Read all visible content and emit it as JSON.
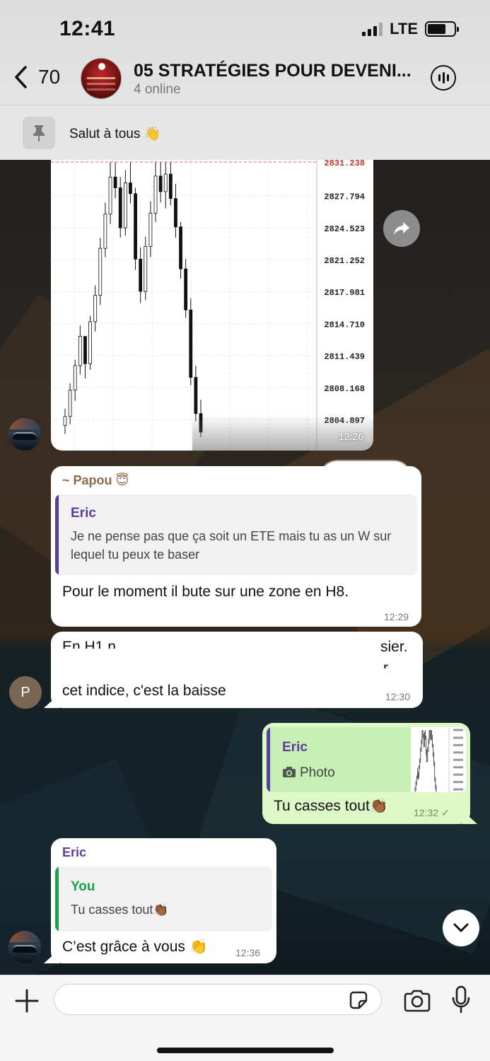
{
  "status_bar": {
    "time": "12:41",
    "network": "LTE"
  },
  "header": {
    "back_count": "70",
    "group_name": "05 STRATÉGIES POUR DEVENI...",
    "online": "4 online"
  },
  "pinned": {
    "text": "Salut à tous 👋"
  },
  "chart_message": {
    "time": "12:26",
    "price_labels": [
      "2831.238",
      "2827.794",
      "2824.523",
      "2821.252",
      "2817.981",
      "2814.710",
      "2811.439",
      "2808.168",
      "2804.897"
    ]
  },
  "chart_data": {
    "type": "candlestick",
    "title": "",
    "ylabel": "",
    "ylim": [
      2803.0,
      2831.238
    ],
    "y_ticks": [
      2831.238,
      2827.794,
      2824.523,
      2821.252,
      2817.981,
      2814.71,
      2811.439,
      2808.168,
      2804.897
    ],
    "ohlc": [
      [
        2804.3,
        2806.0,
        2803.4,
        2805.2
      ],
      [
        2805.2,
        2808.6,
        2804.4,
        2807.9
      ],
      [
        2807.9,
        2811.0,
        2806.8,
        2810.4
      ],
      [
        2810.4,
        2814.5,
        2809.5,
        2813.4
      ],
      [
        2813.4,
        2812.6,
        2809.1,
        2810.6
      ],
      [
        2810.6,
        2815.5,
        2810.0,
        2814.9
      ],
      [
        2814.9,
        2818.6,
        2813.9,
        2817.6
      ],
      [
        2817.6,
        2823.5,
        2816.6,
        2822.4
      ],
      [
        2822.4,
        2827.1,
        2821.5,
        2825.9
      ],
      [
        2825.9,
        2831.2,
        2824.9,
        2829.7
      ],
      [
        2829.7,
        2831.2,
        2827.5,
        2828.6
      ],
      [
        2828.6,
        2829.7,
        2823.5,
        2824.5
      ],
      [
        2824.5,
        2830.4,
        2823.7,
        2829.1
      ],
      [
        2829.1,
        2831.2,
        2827.0,
        2828.0
      ],
      [
        2828.0,
        2828.6,
        2820.2,
        2821.3
      ],
      [
        2821.3,
        2822.5,
        2816.8,
        2818.0
      ],
      [
        2818.0,
        2823.6,
        2817.1,
        2822.6
      ],
      [
        2822.6,
        2827.2,
        2821.5,
        2826.0
      ],
      [
        2826.0,
        2831.2,
        2825.1,
        2829.8
      ],
      [
        2829.8,
        2831.2,
        2827.1,
        2828.2
      ],
      [
        2828.2,
        2831.2,
        2826.5,
        2830.0
      ],
      [
        2830.0,
        2831.2,
        2826.8,
        2827.5
      ],
      [
        2827.5,
        2829.0,
        2823.5,
        2824.6
      ],
      [
        2824.6,
        2825.1,
        2819.3,
        2820.3
      ],
      [
        2820.3,
        2821.3,
        2815.3,
        2816.1
      ],
      [
        2816.1,
        2817.3,
        2808.4,
        2809.2
      ],
      [
        2809.2,
        2810.4,
        2804.7,
        2805.5
      ],
      [
        2805.5,
        2806.9,
        2803.1,
        2803.6
      ]
    ]
  },
  "msg_papou": {
    "sender": "~ Papou 😇",
    "quote_name": "Eric",
    "quote_text": "Je ne pense pas que ça soit un ETE mais tu as un W sur lequel tu peux te baser",
    "text": "Pour le moment il bute sur une zone en H8.",
    "time": "12:29"
  },
  "msg_p": {
    "partial_top_left": "En H1 n",
    "partial_top_right": "sier.",
    "partial_mid_right": "r",
    "text": "cet indice, c'est la baisse",
    "time": "12:30",
    "avatar_letter": "P"
  },
  "msg_you": {
    "quote_name": "Eric",
    "quote_media": "Photo",
    "text": "Tu casses tout👏🏾",
    "time": "12:32",
    "check": "✓"
  },
  "msg_eric": {
    "sender": "Eric",
    "quote_name": "You",
    "quote_text": "Tu casses tout👏🏾",
    "text": "C’est grâce à vous 👏",
    "time": "12:36"
  },
  "input": {
    "placeholder": ""
  },
  "colors": {
    "purple": "#5b3d9e",
    "green_name": "#1aa34a",
    "green_bubble": "#dcf8c6",
    "papou_name": "#8a6a4a"
  },
  "icons": [
    "back-chevron-icon",
    "voice-chat-icon",
    "pin-icon",
    "forward-arrow-icon",
    "camera-icon",
    "chevron-down-icon",
    "plus-icon",
    "sticker-icon",
    "mic-icon"
  ]
}
